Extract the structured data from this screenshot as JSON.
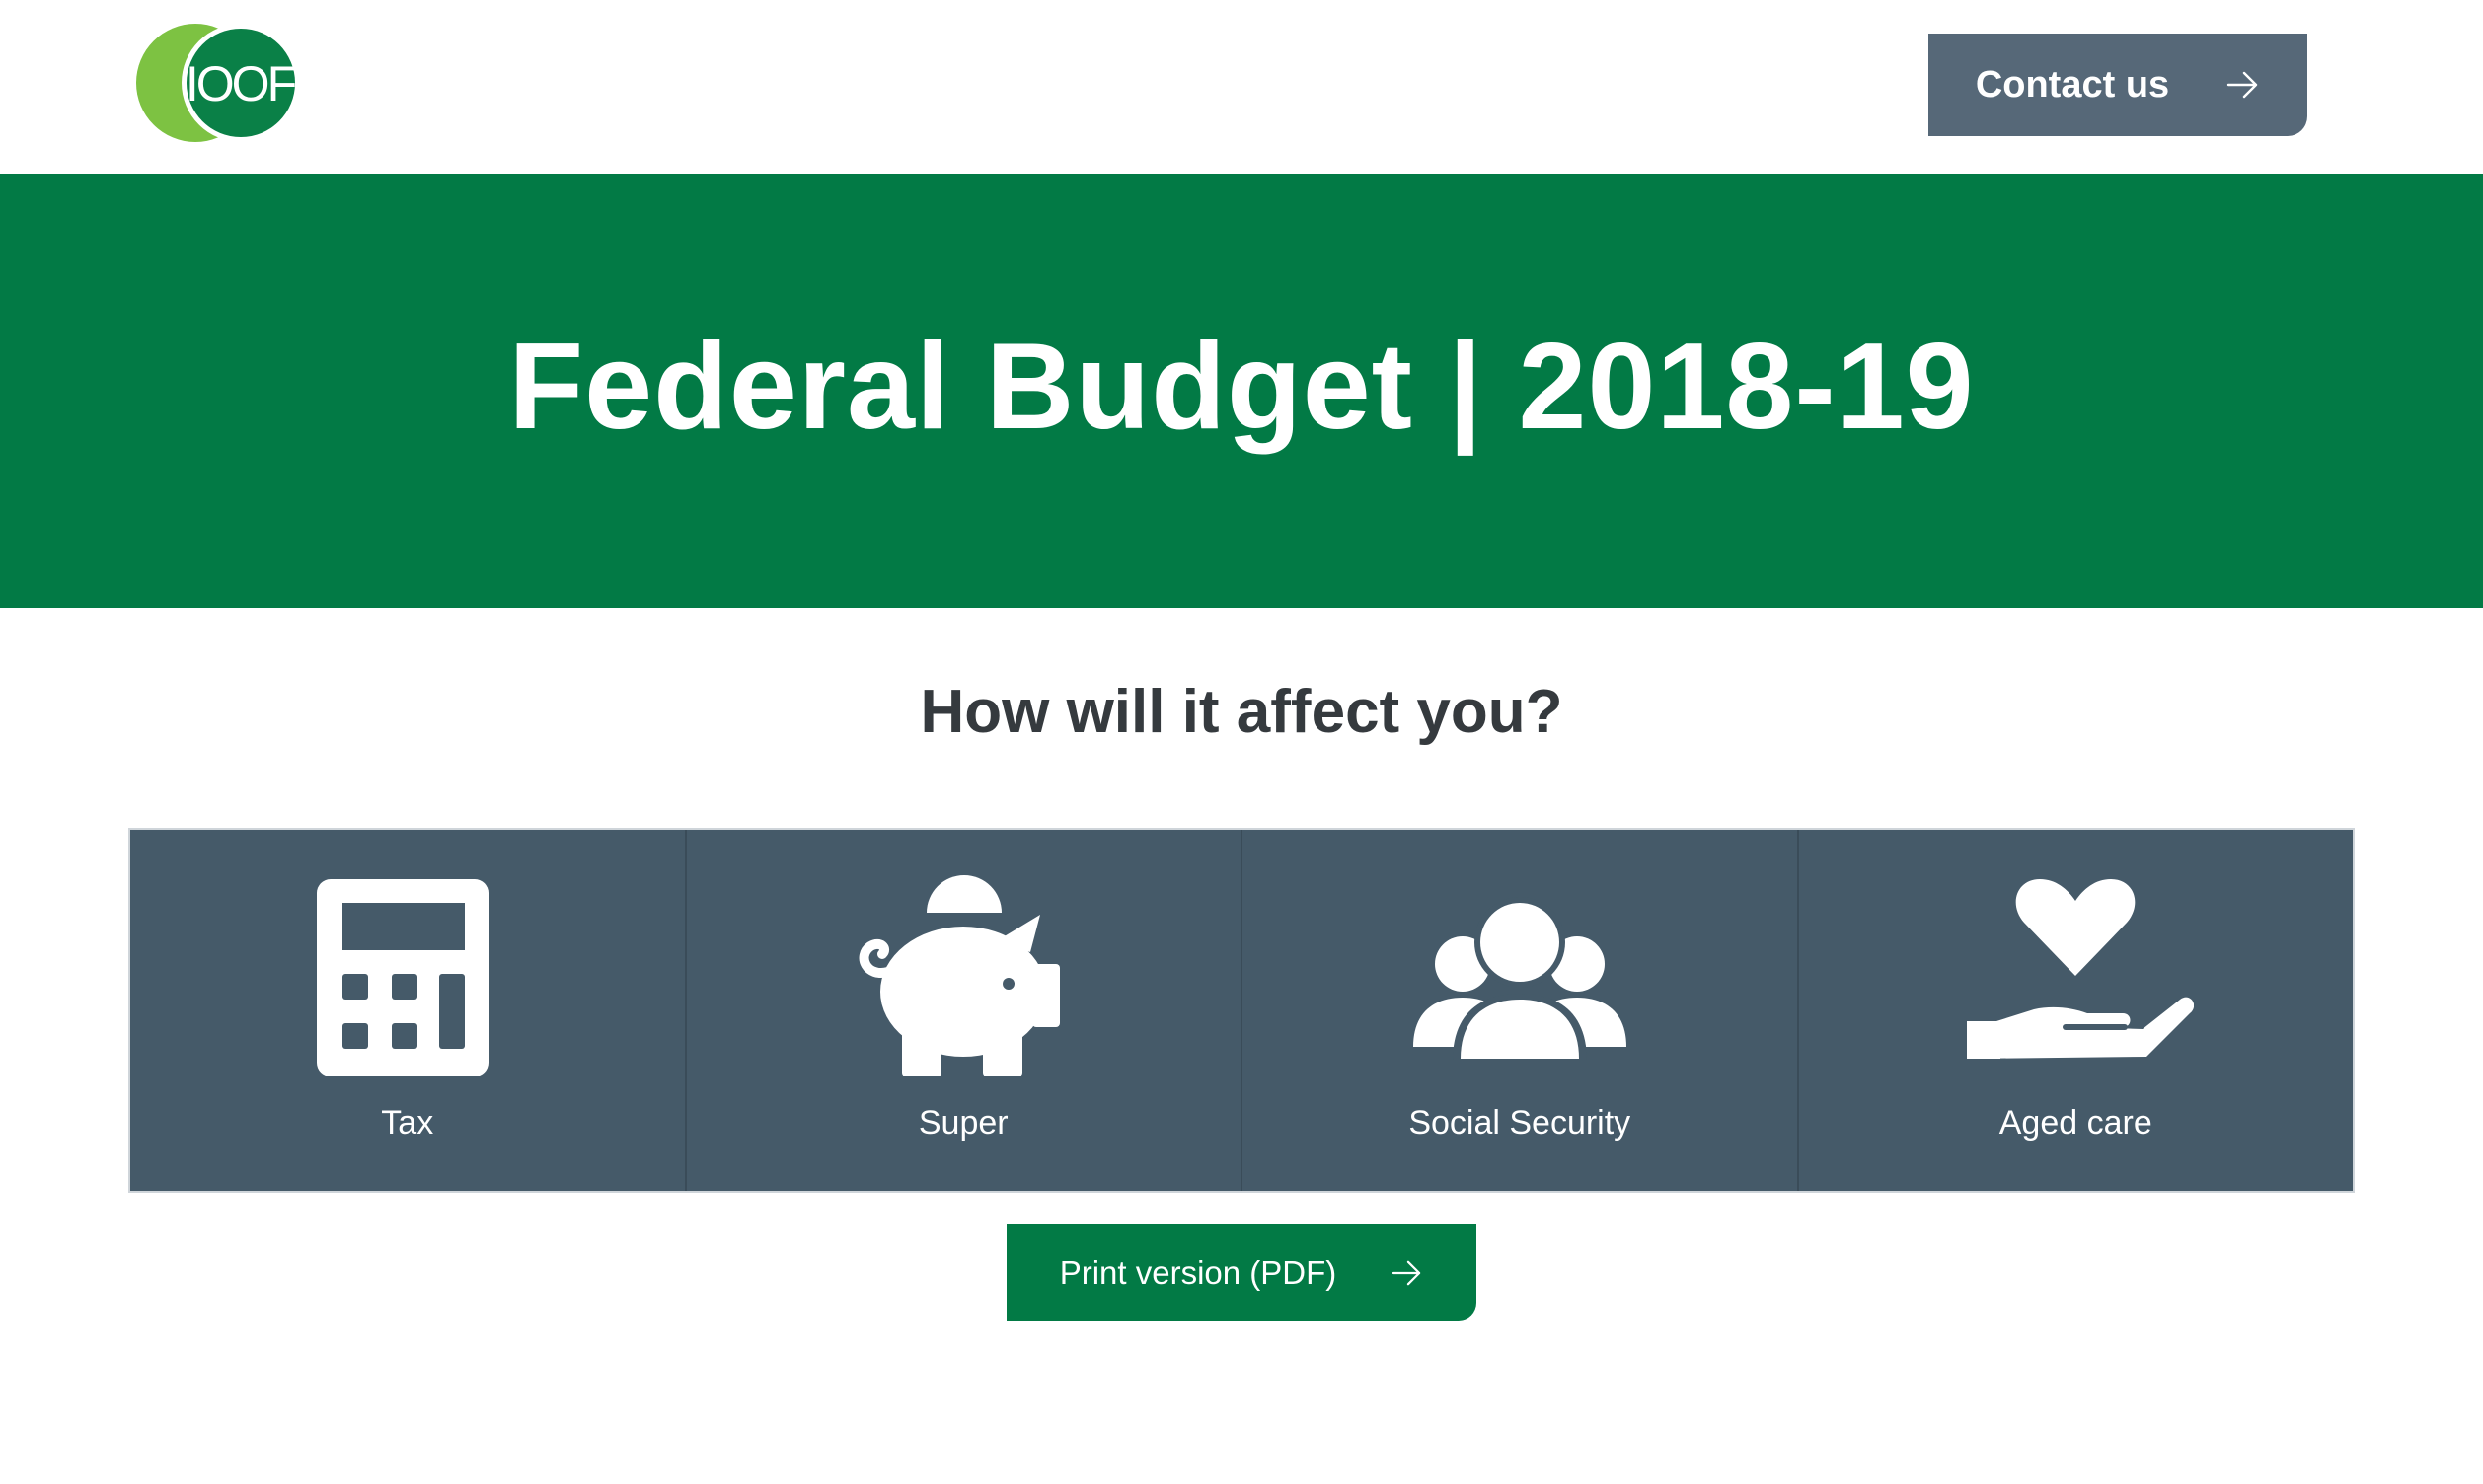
{
  "header": {
    "logo_text": "IOOF",
    "contact_label": "Contact us"
  },
  "hero": {
    "title": "Federal Budget | 2018-19"
  },
  "main": {
    "subheading": "How will it affect you?",
    "tiles": [
      {
        "label": "Tax",
        "icon": "calculator-icon"
      },
      {
        "label": "Super",
        "icon": "piggy-bank-icon"
      },
      {
        "label": "Social Security",
        "icon": "group-icon"
      },
      {
        "label": "Aged care",
        "icon": "heart-hand-icon"
      }
    ],
    "print_label": "Print version (PDF)"
  },
  "colors": {
    "brand_green": "#027a45",
    "logo_light_green": "#7dc242",
    "slate": "#455a69",
    "contact_button": "#566878",
    "heading_text": "#353a3e"
  }
}
